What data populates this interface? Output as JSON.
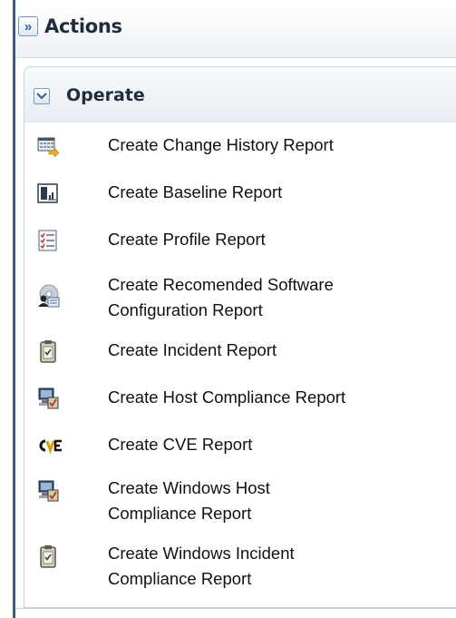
{
  "actions": {
    "title": "Actions",
    "expand_icon": "double-chevron-right-icon"
  },
  "section": {
    "title": "Operate",
    "collapse_icon": "chevron-down-icon"
  },
  "items": [
    {
      "label": "Create Change History Report",
      "icon": "table-arrow-icon"
    },
    {
      "label": "Create Baseline Report",
      "icon": "baseline-chart-icon"
    },
    {
      "label": "Create Profile Report",
      "icon": "checklist-icon"
    },
    {
      "label": "Create Recomended Software\nConfiguration Report",
      "icon": "software-disc-user-icon"
    },
    {
      "label": "Create Incident Report",
      "icon": "clipboard-check-icon"
    },
    {
      "label": "Create Host Compliance Report",
      "icon": "computer-check-icon"
    },
    {
      "label": "Create CVE Report",
      "icon": "cve-logo-icon"
    },
    {
      "label": "Create Windows Host\nCompliance Report",
      "icon": "computer-check-icon"
    },
    {
      "label": "Create Windows Incident\nCompliance Report",
      "icon": "clipboard-check-icon"
    }
  ],
  "colors": {
    "accent": "#3b5a84",
    "header_gradient_end": "#e7edf3"
  }
}
